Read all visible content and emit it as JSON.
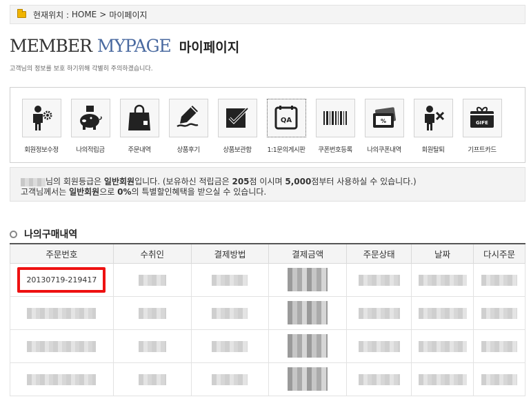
{
  "breadcrumb": {
    "label": "현재위치 :",
    "home": "HOME",
    "separator": ">",
    "current": "마이페이지"
  },
  "title": {
    "en_part1": "MEMBER",
    "en_part2": "MYPAGE",
    "kr": "마이페이지",
    "accent_color": "#4a6aa0"
  },
  "notice": "고객님의 정보를 보호 하기위해 각별히 주의하겠습니다.",
  "menu": [
    {
      "label": "회원정보수정",
      "icon": "member-info-icon"
    },
    {
      "label": "나의적립금",
      "icon": "piggy-bank-icon"
    },
    {
      "label": "주문내역",
      "icon": "shopping-bag-icon"
    },
    {
      "label": "상품후기",
      "icon": "pen-icon"
    },
    {
      "label": "상품보관함",
      "icon": "box-check-icon"
    },
    {
      "label": "1:1문의게시판",
      "icon": "qa-icon"
    },
    {
      "label": "쿠폰번호등록",
      "icon": "barcode-icon"
    },
    {
      "label": "나의쿠폰내역",
      "icon": "coupon-icon"
    },
    {
      "label": "회원탈퇴",
      "icon": "member-remove-icon"
    },
    {
      "label": "기프트카드",
      "icon": "gift-card-icon"
    }
  ],
  "grade": {
    "line1_a": "님의 회원등급은 ",
    "grade_name": "일반회원",
    "line1_b": "입니다. (보유하신 적립금은 ",
    "points": "205",
    "line1_c": "점 이시며 ",
    "min_points": "5,000",
    "line1_d": "점부터 사용하실 수 있습니다.)",
    "line2_a": "고객님께서는 ",
    "line2_grade": "일반회원",
    "line2_b": "으로 ",
    "discount": "0%",
    "line2_c": "의 특별할인혜택을 받으실 수 있습니다."
  },
  "orders": {
    "section_title": "나의구매내역",
    "columns": [
      "주문번호",
      "수취인",
      "결제방법",
      "결제금액",
      "주문상태",
      "날짜",
      "다시주문"
    ],
    "highlight_color": "#ee1111",
    "first_order_no": "20130719-219417"
  }
}
